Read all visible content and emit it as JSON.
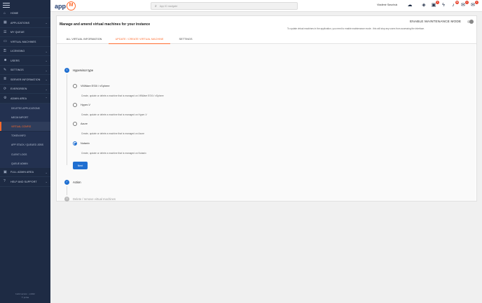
{
  "sidebar": {
    "items": [
      {
        "label": "HOME",
        "icon": "home-icon",
        "glyph": "⌂",
        "chev": ""
      },
      {
        "label": "APPLICATIONS",
        "icon": "apps-icon",
        "glyph": "▦",
        "chev": "⌄"
      },
      {
        "label": "MY QUEUE",
        "icon": "queue-icon",
        "glyph": "☰",
        "chev": ""
      },
      {
        "label": "VIRTUAL MACHINES",
        "icon": "monitor-icon",
        "glyph": "▭",
        "chev": ""
      },
      {
        "label": "LICENSING",
        "icon": "key-icon",
        "glyph": "⚿",
        "chev": "⌄"
      },
      {
        "label": "USERS",
        "icon": "users-icon",
        "glyph": "☻",
        "chev": "⌄"
      },
      {
        "label": "SETTINGS",
        "icon": "wrench-icon",
        "glyph": "✎",
        "chev": "⌄"
      },
      {
        "label": "SERVER INFORMATION",
        "icon": "server-icon",
        "glyph": "≣",
        "chev": "⌄"
      },
      {
        "label": "EVERGREEN",
        "icon": "evergreen-icon",
        "glyph": "⟳",
        "chev": "⌄"
      },
      {
        "label": "ADMIN AREA",
        "icon": "gear-icon",
        "glyph": "⚙",
        "chev": "⌃"
      }
    ],
    "sub_items": [
      {
        "label": "DELETED APPLICATIONS"
      },
      {
        "label": "MECM IMPORT"
      },
      {
        "label": "VIRTUAL CONFIG",
        "active": true
      },
      {
        "label": "TOKEN INFO"
      },
      {
        "label": "APP STACK / QUEUED JOBS"
      },
      {
        "label": "CLIENT LOGS"
      },
      {
        "label": "QUEUE ADMIN"
      }
    ],
    "bottom_items": [
      {
        "label": "FULL ADMIN AREA",
        "icon": "admin-icon",
        "glyph": "▣",
        "chev": "⌄"
      },
      {
        "label": "HELP AND SUPPORT",
        "icon": "help-icon",
        "glyph": "?",
        "chev": "⌄"
      }
    ],
    "footer": {
      "line1": "build version - v4322",
      "line2": "© juriba"
    }
  },
  "topbar": {
    "logo_text": "app",
    "logo_mark": "M",
    "search_placeholder": "App ID navigate",
    "username": "Vladimir Savchuk",
    "icons": [
      {
        "name": "cloud-icon",
        "glyph": "☁",
        "badge": ""
      },
      {
        "name": "layers-icon",
        "glyph": "◈",
        "badge": ""
      },
      {
        "name": "display-icon",
        "glyph": "▣",
        "badge": "5"
      },
      {
        "name": "bolt-icon",
        "glyph": "ϟ",
        "badge": ""
      },
      {
        "name": "bell-icon",
        "glyph": "♪",
        "badge": "99"
      },
      {
        "name": "chat-icon",
        "glyph": "✉",
        "badge": "2"
      },
      {
        "name": "mail-icon",
        "glyph": "✉",
        "badge": "4"
      }
    ]
  },
  "card": {
    "title": "Manage and amend virtual machines for your instance",
    "maintenance_label": "ENABLE MAINTENANCE MODE",
    "maintenance_desc": "To update virtual machines in the application, you need to enable maintenance mode - this will stop any users from accessing the interface.",
    "tabs": [
      {
        "label": "ALL VIRTUAL INFORMATION",
        "active": false
      },
      {
        "label": "UPDATE / CREATE VIRTUAL MACHINE",
        "active": true
      },
      {
        "label": "SETTINGS",
        "active": false
      }
    ]
  },
  "wizard": {
    "step1": {
      "num": "1",
      "title": "Hypervisor type"
    },
    "options": [
      {
        "label": "VMWare ESXi / vSphere",
        "desc": "Create, update or delete a machine that is managed on VMWare ESXi / vSphere",
        "checked": false
      },
      {
        "label": "Hyper-V",
        "desc": "Create, update or delete a machine that is managed on Hyper-V",
        "checked": false
      },
      {
        "label": "Azure",
        "desc": "Create, update or delete a machine that is managed on Azure",
        "checked": false
      },
      {
        "label": "Nutanix",
        "desc": "Create, update or delete a machine that is managed on Nutanix",
        "checked": true
      }
    ],
    "next_label": "Next",
    "step2": {
      "num": "✓",
      "title": "Action"
    },
    "step3": {
      "num": "3",
      "title": "Delete / remove virtual machines"
    }
  }
}
